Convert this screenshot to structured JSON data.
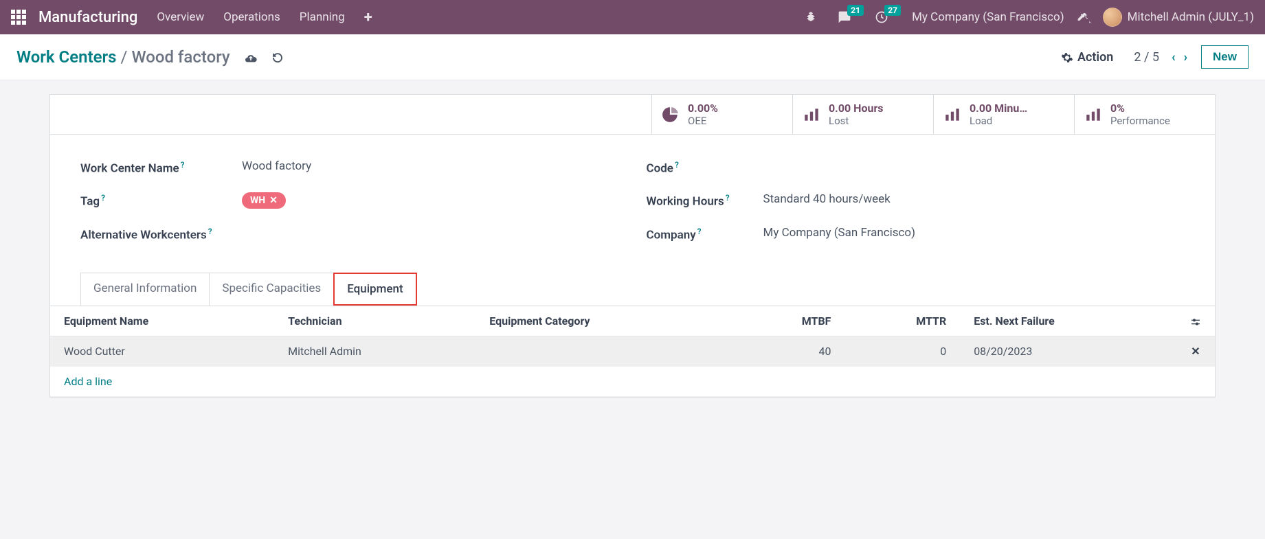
{
  "navbar": {
    "brand": "Manufacturing",
    "links": [
      "Overview",
      "Operations",
      "Planning"
    ],
    "messages_badge": "21",
    "activities_badge": "27",
    "company": "My Company (San Francisco)",
    "user": "Mitchell Admin (JULY_1)"
  },
  "actionbar": {
    "breadcrumb_root": "Work Centers",
    "breadcrumb_current": "Wood factory",
    "action_label": "Action",
    "pager": "2 / 5",
    "new_label": "New"
  },
  "stats": [
    {
      "value": "0.00%",
      "label": "OEE",
      "icon": "pie"
    },
    {
      "value": "0.00 Hours",
      "label": "Lost",
      "icon": "bars"
    },
    {
      "value": "0.00 Minu…",
      "label": "Load",
      "icon": "bars"
    },
    {
      "value": "0%",
      "label": "Performance",
      "icon": "bars"
    }
  ],
  "form": {
    "labels": {
      "name": "Work Center Name",
      "tag": "Tag",
      "alt": "Alternative Workcenters",
      "code": "Code",
      "hours": "Working Hours",
      "company": "Company"
    },
    "values": {
      "name": "Wood factory",
      "tag": "WH",
      "code": "",
      "hours": "Standard 40 hours/week",
      "company": "My Company (San Francisco)"
    }
  },
  "tabs": [
    "General Information",
    "Specific Capacities",
    "Equipment"
  ],
  "table": {
    "headers": {
      "name": "Equipment Name",
      "technician": "Technician",
      "category": "Equipment Category",
      "mtbf": "MTBF",
      "mttr": "MTTR",
      "next": "Est. Next Failure"
    },
    "rows": [
      {
        "name": "Wood Cutter",
        "technician": "Mitchell Admin",
        "category": "",
        "mtbf": "40",
        "mttr": "0",
        "next": "08/20/2023"
      }
    ],
    "add_line": "Add a line"
  }
}
